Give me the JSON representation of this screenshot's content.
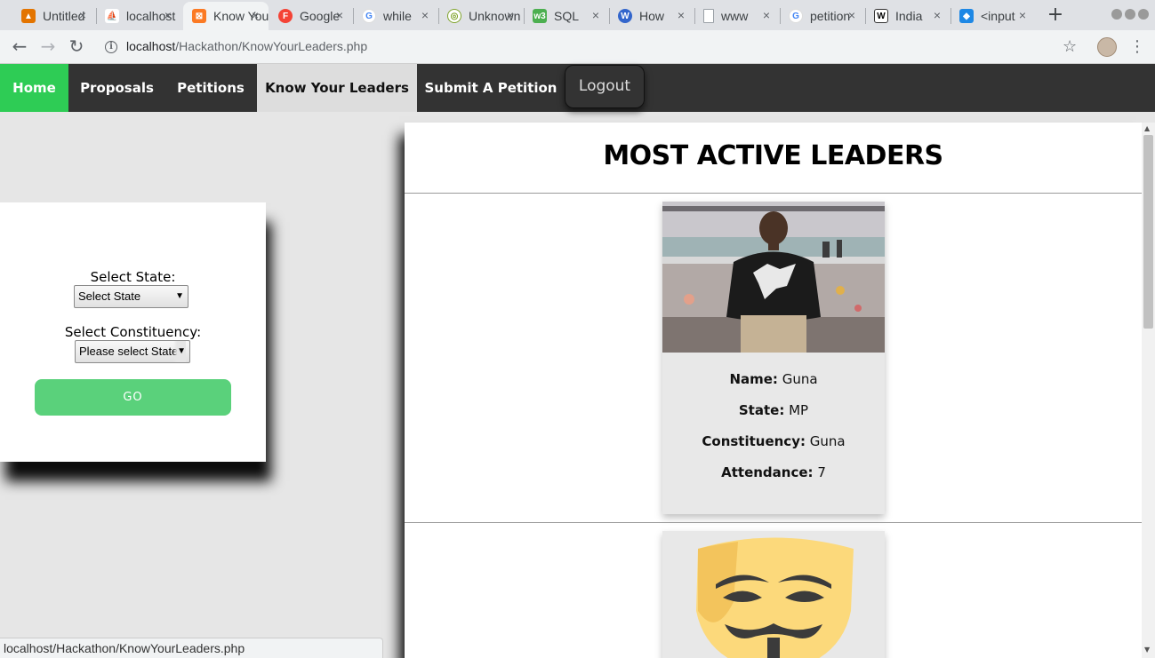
{
  "browser": {
    "tabs": [
      {
        "title": "Untitled",
        "favicon": "triangle-orange-icon",
        "color": "#e37400",
        "active": false
      },
      {
        "title": "localhost",
        "favicon": "pma-icon",
        "color": "#6c78af",
        "active": false
      },
      {
        "title": "Know Your Leaders",
        "favicon": "xampp-icon",
        "color": "#fb7a24",
        "active": true
      },
      {
        "title": "Google",
        "favicon": "firebase-icon",
        "color": "#f44336",
        "active": false
      },
      {
        "title": "while",
        "favicon": "google-icon",
        "color": "#4285f4",
        "active": false
      },
      {
        "title": "Unknown",
        "favicon": "leaf-icon",
        "color": "#a6c93a",
        "active": false
      },
      {
        "title": "SQL",
        "favicon": "w3-icon",
        "color": "#4caf50",
        "active": false
      },
      {
        "title": "How",
        "favicon": "wiki-w-icon",
        "color": "#3366cc",
        "active": false
      },
      {
        "title": "www",
        "favicon": "page-icon",
        "color": "#9aa0a6",
        "active": false
      },
      {
        "title": "petition",
        "favicon": "google-icon",
        "color": "#4285f4",
        "active": false
      },
      {
        "title": "India",
        "favicon": "wikipedia-icon",
        "color": "#333333",
        "active": false
      },
      {
        "title": "<input",
        "favicon": "so-icon",
        "color": "#1e88e5",
        "active": false
      }
    ],
    "url_host": "localhost",
    "url_path": "/Hackathon/KnowYourLeaders.php",
    "status_text": "localhost/Hackathon/KnowYourLeaders.php"
  },
  "nav": {
    "home": "Home",
    "proposals": "Proposals",
    "petitions": "Petitions",
    "know_your_leaders": "Know Your Leaders",
    "submit_petition": "Submit A Petition",
    "logout": "Logout"
  },
  "filter": {
    "state_label": "Select State:",
    "state_value": "Select State",
    "constituency_label": "Select Constituency:",
    "constituency_value": "Please select State",
    "go_label": "GO"
  },
  "main": {
    "title": "MOST ACTIVE LEADERS",
    "leaders": [
      {
        "name_label": "Name:",
        "name": "Guna",
        "state_label": "State:",
        "state": "MP",
        "constituency_label": "Constituency:",
        "constituency": "Guna",
        "attendance_label": "Attendance:",
        "attendance": "7"
      }
    ]
  },
  "colors": {
    "nav_bg": "#333333",
    "home_active": "#2ecc55",
    "go_button": "#5ad17b",
    "page_bg": "#e6e6e6"
  }
}
